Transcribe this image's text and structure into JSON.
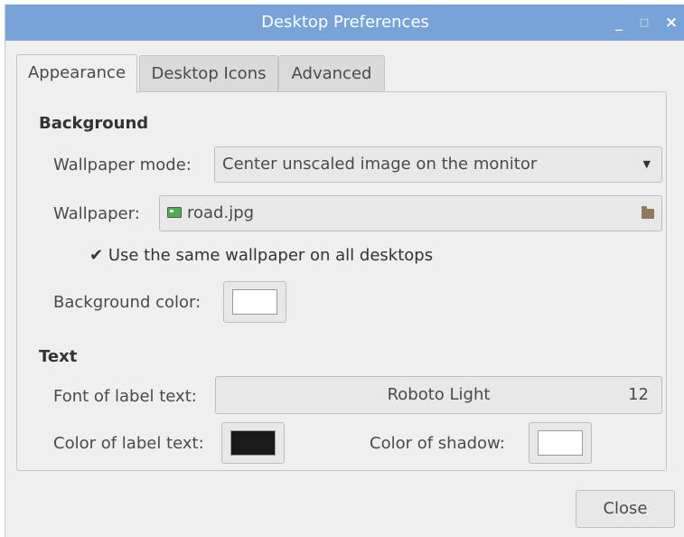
{
  "window": {
    "title": "Desktop Preferences",
    "controls": {
      "minimize": "_",
      "maximize": "□",
      "close": "×"
    }
  },
  "tabs": [
    {
      "label": "Appearance",
      "active": true
    },
    {
      "label": "Desktop Icons",
      "active": false
    },
    {
      "label": "Advanced",
      "active": false
    }
  ],
  "background": {
    "section_title": "Background",
    "wallpaper_mode_label": "Wallpaper mode:",
    "wallpaper_mode_value": "Center unscaled image on the monitor",
    "wallpaper_label": "Wallpaper:",
    "wallpaper_file": "road.jpg",
    "same_wallpaper_label": "Use the same wallpaper on all desktops",
    "same_wallpaper_checked": true,
    "background_color_label": "Background color:",
    "background_color": "#ffffff"
  },
  "text": {
    "section_title": "Text",
    "font_label": "Font of label text:",
    "font_name": "Roboto Light",
    "font_size": "12",
    "label_color_label": "Color of label text:",
    "label_color": "#1a1a1a",
    "shadow_color_label": "Color of shadow:",
    "shadow_color": "#ffffff"
  },
  "footer": {
    "close_label": "Close"
  },
  "icons": {
    "file": "image-file-icon",
    "folder": "folder-icon",
    "dropdown": "chevron-down-icon",
    "check": "checkmark-icon"
  },
  "colors": {
    "titlebar": "#78a3d8",
    "window_bg": "#efefef"
  }
}
